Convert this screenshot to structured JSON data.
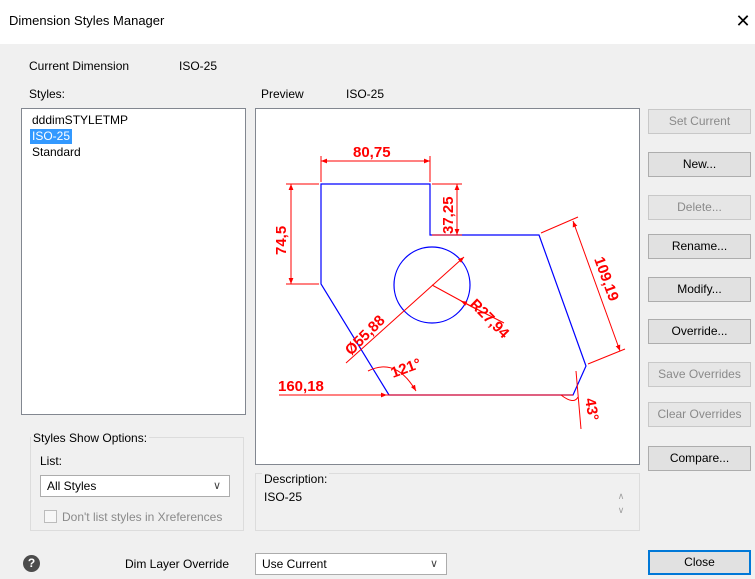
{
  "window": {
    "title": "Dimension Styles Manager",
    "close_glyph": "✕"
  },
  "current_dimension": {
    "label": "Current Dimension",
    "value": "ISO-25"
  },
  "styles": {
    "label": "Styles:",
    "items": [
      {
        "name": "dddimSTYLETMP",
        "selected": false
      },
      {
        "name": "ISO-25",
        "selected": true
      },
      {
        "name": "Standard",
        "selected": false
      }
    ]
  },
  "preview": {
    "label": "Preview",
    "value": "ISO-25",
    "dim_color": "#ff0000",
    "geom_color": "#0000ff",
    "dimensions": {
      "top_width": "80,75",
      "notch_depth": "37,25",
      "left_height": "74,5",
      "bottom_width": "160,18",
      "diameter": "Ø55,88",
      "radius": "R27,94",
      "slant_length": "109,19",
      "angle_main": "121°",
      "angle_corner": "43°"
    }
  },
  "show_options": {
    "group_label": "Styles Show Options:",
    "list_label": "List:",
    "list_value": "All Styles",
    "xref_checkbox_label": "Don't list styles in Xreferences",
    "xref_checked": false
  },
  "description": {
    "label": "Description:",
    "text": "ISO-25"
  },
  "buttons": {
    "set_current": "Set Current",
    "new": "New...",
    "delete": "Delete...",
    "rename": "Rename...",
    "modify": "Modify...",
    "override": "Override...",
    "save_overrides": "Save Overrides",
    "clear_overrides": "Clear Overrides",
    "compare": "Compare...",
    "close": "Close"
  },
  "dim_layer_override": {
    "label": "Dim Layer Override",
    "value": "Use Current"
  },
  "help_glyph": "?"
}
